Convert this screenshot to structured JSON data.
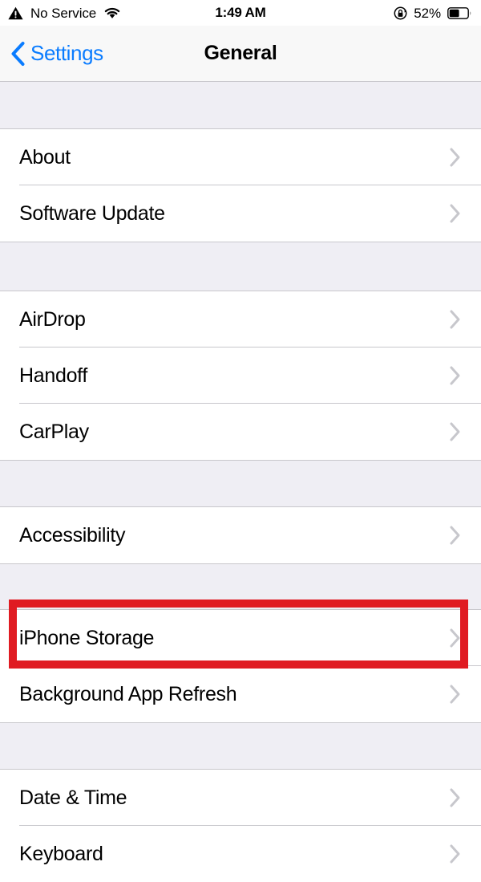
{
  "status_bar": {
    "carrier": "No Service",
    "carrier_icon": "warning-triangle-icon",
    "wifi_icon": "wifi-icon",
    "time": "1:49 AM",
    "rotation_lock_icon": "rotation-lock-icon",
    "battery_percent": "52%",
    "battery_icon": "battery-icon",
    "battery_level": 52
  },
  "nav_bar": {
    "back_icon": "chevron-left-icon",
    "back_label": "Settings",
    "title": "General"
  },
  "colors": {
    "tint_blue": "#0a7cff",
    "group_bg": "#ffffff",
    "page_bg": "#efeef4",
    "separator": "#c8c7cc",
    "chevron": "#c7c7cc",
    "annotation_red": "#e01b22",
    "navbar_bg": "#f8f8f8"
  },
  "annotation": {
    "target": "iPhone Storage",
    "shape": "rectangle",
    "color": "#e01b22"
  },
  "sections": [
    {
      "id": "section-info",
      "rows": [
        {
          "label": "About",
          "accessory": "chevron-right-icon"
        },
        {
          "label": "Software Update",
          "accessory": "chevron-right-icon"
        }
      ]
    },
    {
      "id": "section-continuity",
      "rows": [
        {
          "label": "AirDrop",
          "accessory": "chevron-right-icon"
        },
        {
          "label": "Handoff",
          "accessory": "chevron-right-icon"
        },
        {
          "label": "CarPlay",
          "accessory": "chevron-right-icon"
        }
      ]
    },
    {
      "id": "section-accessibility",
      "rows": [
        {
          "label": "Accessibility",
          "accessory": "chevron-right-icon"
        }
      ]
    },
    {
      "id": "section-storage",
      "rows": [
        {
          "label": "iPhone Storage",
          "accessory": "chevron-right-icon",
          "highlighted": true
        },
        {
          "label": "Background App Refresh",
          "accessory": "chevron-right-icon"
        }
      ]
    },
    {
      "id": "section-datetime",
      "rows": [
        {
          "label": "Date & Time",
          "accessory": "chevron-right-icon"
        },
        {
          "label": "Keyboard",
          "accessory": "chevron-right-icon"
        }
      ]
    }
  ]
}
